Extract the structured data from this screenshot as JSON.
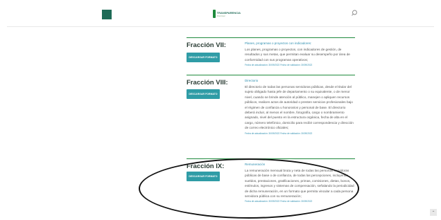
{
  "header": {
    "logo_line1": "TRANSPARENCIA",
    "logo_line2": "Municipal"
  },
  "rows": [
    {
      "title": "Fracción VII:",
      "button": "DESCARGAR FORMATO",
      "heading": "Planes, programas o proyectos con indicadores:",
      "body": "Los planes, programas o proyectos, con indicadores de gestión, de resultados y sus metas, que permitan evaluar su desempeño por área de conformidad con sus programas operativos;",
      "dates": "Fecha de actualización: 30/09/2022 Fecha de validación: 30/09/2022"
    },
    {
      "title": "Fracción VIII:",
      "button": "DESCARGAR FORMATO",
      "heading": "Directorio",
      "body": "El directorio de todas las personas servidoras públicas, desde el titular del sujeto obligado hasta jefe de departamento o su equivalente, o de menor nivel, cuando se brinde atención al público, manejen o apliquen recursos públicos, realicen actos de autoridad o presten servicios profesionales bajo el régimen de confianza u honorarios y personal de base. El directorio deberá incluir, al menos el nombre, fotografía, cargo o nombramiento asignado, nivel del puesto en la estructura orgánica, fecha de alta en el cargo, número telefónico, domicilio para recibir correspondencia y dirección de correo electrónico oficiales;",
      "dates": "Fecha de actualización: 30/09/2022 Fecha de validación: 30/09/2022"
    },
    {
      "title": "Fracción IX:",
      "button": "DESCARGAR FORMATO",
      "heading": "Remuneración",
      "body": "La remuneración mensual bruta y neta de todas las personas servidoras públicas de base o de confianza, de todas las percepciones, incluyendo sueldos, prestaciones, gratificaciones, primas, comisiones, dietas, bonos, estímulos, ingresos y sistemas de compensación, señalando la periodicidad de dicha remuneración, en un formato que permita vincular a cada persona servidora pública con su remuneración;",
      "dates": "Fecha de actualización: 30/09/2022 Fecha de validación: 30/09/2022"
    }
  ],
  "scroll_top": "⌃"
}
